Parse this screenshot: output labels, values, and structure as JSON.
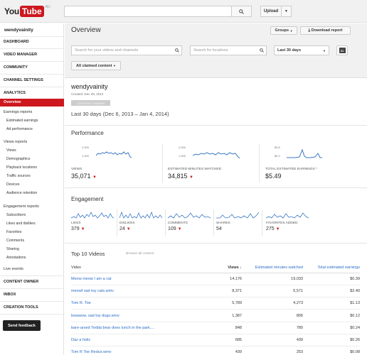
{
  "header": {
    "logo_you": "You",
    "logo_tube": "Tube",
    "logo_suffix": "AU",
    "search_placeholder": "",
    "upload_label": "Upload"
  },
  "sidebar": {
    "username": "wendyvainity",
    "dashboard": "DASHBOARD",
    "video_manager": "VIDEO MANAGER",
    "community": "COMMUNITY",
    "channel_settings": "CHANNEL SETTINGS",
    "analytics": "ANALYTICS",
    "overview": "Overview",
    "earnings_reports": "Earnings reports",
    "estimated_earnings": "Estimated earnings",
    "ad_performance": "Ad performance",
    "views_reports": "Views reports",
    "views": "Views",
    "demographics": "Demographics",
    "playback_locations": "Playback locations",
    "traffic_sources": "Traffic sources",
    "devices": "Devices",
    "audience_retention": "Audience retention",
    "engagement_reports": "Engagement reports",
    "subscribers": "Subscribers",
    "likes_dislikes": "Likes and dislikes",
    "favorites": "Favorites",
    "comments": "Comments",
    "sharing": "Sharing",
    "annotations": "Annotations",
    "live_events": "Live events",
    "content_owner": "CONTENT OWNER",
    "inbox": "INBOX",
    "creation_tools": "CREATION TOOLS",
    "send_feedback": "Send feedback"
  },
  "main": {
    "title": "Overview",
    "groups_label": "Groups",
    "download_label": "Download report",
    "search_videos_placeholder": "Search for your videos and channels",
    "search_locations_placeholder": "Search for locations",
    "period_select": "Last 30 days",
    "calendar_label": "31",
    "content_filter": "All claimed content",
    "channel_name": "wendyvainity",
    "created": "Created: Dec 28, 2012",
    "badge": "CONTENT OWNER",
    "date_range": "Last 30 days (Dec 6, 2013 – Jan 4, 2014)"
  },
  "performance": {
    "title": "Performance",
    "views_label": "VIEWS",
    "views_value": "35,071",
    "minutes_label": "ESTIMATED MINUTES WATCHED",
    "minutes_value": "34,815",
    "earnings_label": "TOTAL ESTIMATED EARNINGS *",
    "earnings_value": "$5.49",
    "axis_views_top": "2,000",
    "axis_views_mid": "1,000",
    "axis_minutes_top": "2,000",
    "axis_minutes_mid": "1,000",
    "axis_earn_top": "$0.6",
    "axis_earn_mid": "$0.2"
  },
  "engagement": {
    "title": "Engagement",
    "likes_label": "LIKES",
    "likes_value": "379",
    "dislikes_label": "DISLIKES",
    "dislikes_value": "24",
    "comments_label": "COMMENTS",
    "comments_value": "109",
    "shares_label": "SHARES",
    "shares_value": "54",
    "favorites_label": "FAVORITES ADDED",
    "favorites_value": "275"
  },
  "top_videos": {
    "title": "Top 10 Videos",
    "browse_link": "Browse all content",
    "col_video": "Video",
    "col_views": "Views",
    "col_minutes": "Estimated minutes watched",
    "col_earnings": "Total estimated earnings",
    "rows": [
      {
        "name": "Meow meow I am a cat",
        "views": "14,176",
        "minutes": "19,033",
        "earnings": "$0.39"
      },
      {
        "name": "meowf sad toy cats.wmv",
        "views": "8,371",
        "minutes": "5,571",
        "earnings": "$2.40"
      },
      {
        "name": "Tom R. Toe",
        "views": "5,789",
        "minutes": "4,273",
        "earnings": "$1.13"
      },
      {
        "name": "bowwow, sad toy dogs.wmv",
        "views": "1,387",
        "minutes": "806",
        "earnings": "$0.12"
      },
      {
        "name": "bare-arsed Tedda bear does lunch in the park....",
        "views": "848",
        "minutes": "780",
        "earnings": "$0.24"
      },
      {
        "name": "Daz a holic",
        "views": "685",
        "minutes": "439",
        "earnings": "$0.26"
      },
      {
        "name": "Tom R Toe Redux.wmv",
        "views": "439",
        "minutes": "253",
        "earnings": "$0.08"
      }
    ]
  }
}
